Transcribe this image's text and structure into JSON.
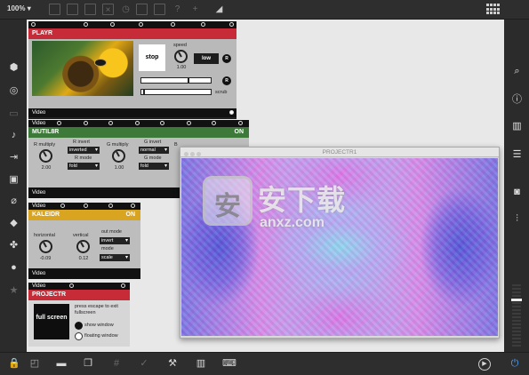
{
  "topbar": {
    "zoom": "100%"
  },
  "playr": {
    "title": "PLAYR",
    "stop_label": "stop",
    "speed_label": "speed",
    "speed_value": "1.00",
    "low_label": "low",
    "r_label": "R",
    "scrub_label": "scrub",
    "footer": "Video",
    "color": "#c62b37"
  },
  "mutil8r": {
    "title": "MUTIL8R",
    "state": "ON",
    "header": "Video",
    "r_multiply_label": "R multiply",
    "r_multiply_value": "2.00",
    "r_invert_label": "R invert",
    "r_invert_value": "inverted",
    "r_mode_label": "R mode",
    "r_mode_value": "fold",
    "g_multiply_label": "G multiply",
    "g_multiply_value": "1.00",
    "g_invert_label": "G invert",
    "g_invert_value": "normal",
    "g_mode_label": "G mode",
    "g_mode_value": "fold",
    "b_label": "B",
    "footer": "Video",
    "color": "#3d7a3a"
  },
  "kaleidr": {
    "title": "KALEIDR",
    "state": "ON",
    "header": "Video",
    "horizontal_label": "horizontal",
    "horizontal_value": "-0.09",
    "vertical_label": "vertical",
    "vertical_value": "0.12",
    "out_mode_label": "out mode",
    "out_mode_value": "invert",
    "mode_label": "mode",
    "mode_value": "scale",
    "footer": "Video",
    "color": "#d9a521"
  },
  "projectr": {
    "title": "PROJECTR",
    "header": "Video",
    "fullscreen_label": "full screen",
    "escape_text": "press escape to exit fullscreen",
    "show_window_label": "show window",
    "floating_window_label": "floating window",
    "color": "#c62b37"
  },
  "window": {
    "title": "PROJECTR1"
  },
  "watermark": {
    "badge": "安",
    "text": "安下载",
    "url": "anxz.com"
  },
  "icons": {
    "left": [
      "cube-icon",
      "target-icon",
      "keyboard-icon",
      "music-note-icon",
      "bracket-icon",
      "image-icon",
      "paperclip-icon",
      "plug-icon",
      "puzzle-icon",
      "star-icon"
    ],
    "right": [
      "search-icon",
      "info-icon",
      "columns-icon",
      "list-icon",
      "camera-icon",
      "sliders-icon"
    ],
    "bottom": [
      "lock-icon",
      "presentation-icon",
      "comment-icon",
      "windows-icon",
      "grid-icon",
      "debug-icon",
      "wrench-icon",
      "piano-icon",
      "keyboard-icon",
      "play-icon",
      "power-icon"
    ]
  }
}
